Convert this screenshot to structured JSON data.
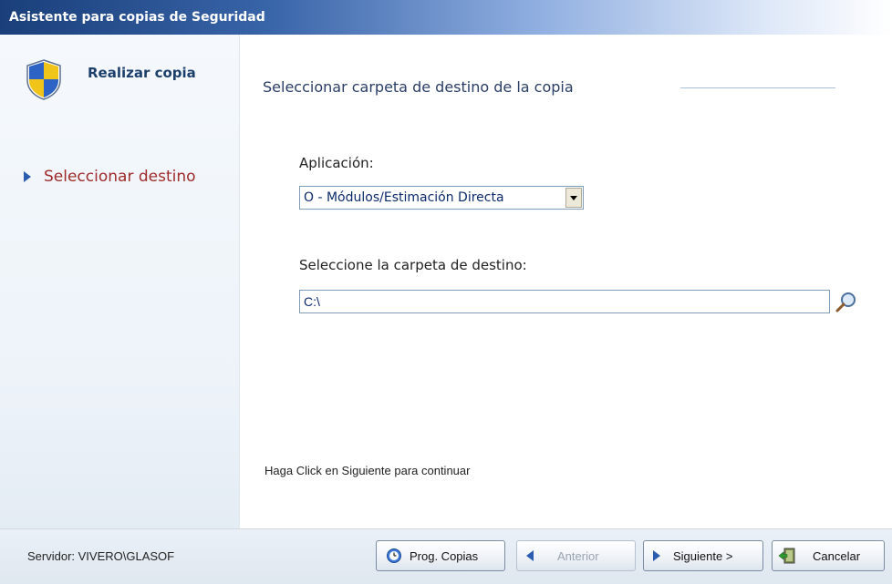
{
  "window": {
    "title": "Asistente para copias de Seguridad"
  },
  "sidebar": {
    "title": "Realizar copia",
    "steps": [
      {
        "label": "Seleccionar destino",
        "icon": "triangle-right-icon",
        "active": true
      }
    ],
    "active_color": "#9e2a2a"
  },
  "main": {
    "heading": "Seleccionar carpeta de destino de la copia",
    "application_label": "Aplicación:",
    "application_value": "O - Módulos/Estimación Directa",
    "folder_label": "Seleccione la carpeta de destino:",
    "folder_value": "C:\\",
    "hint": "Haga Click en Siguiente para continuar"
  },
  "footer": {
    "server": "Servidor: VIVERO\\GLASOF",
    "buttons": {
      "prog_copias": "Prog. Copias",
      "anterior": "Anterior",
      "siguiente": "Siguiente >",
      "cancelar": "Cancelar"
    }
  },
  "colors": {
    "accent": "#2a5db0",
    "title_bar": "#1a3f7a"
  }
}
